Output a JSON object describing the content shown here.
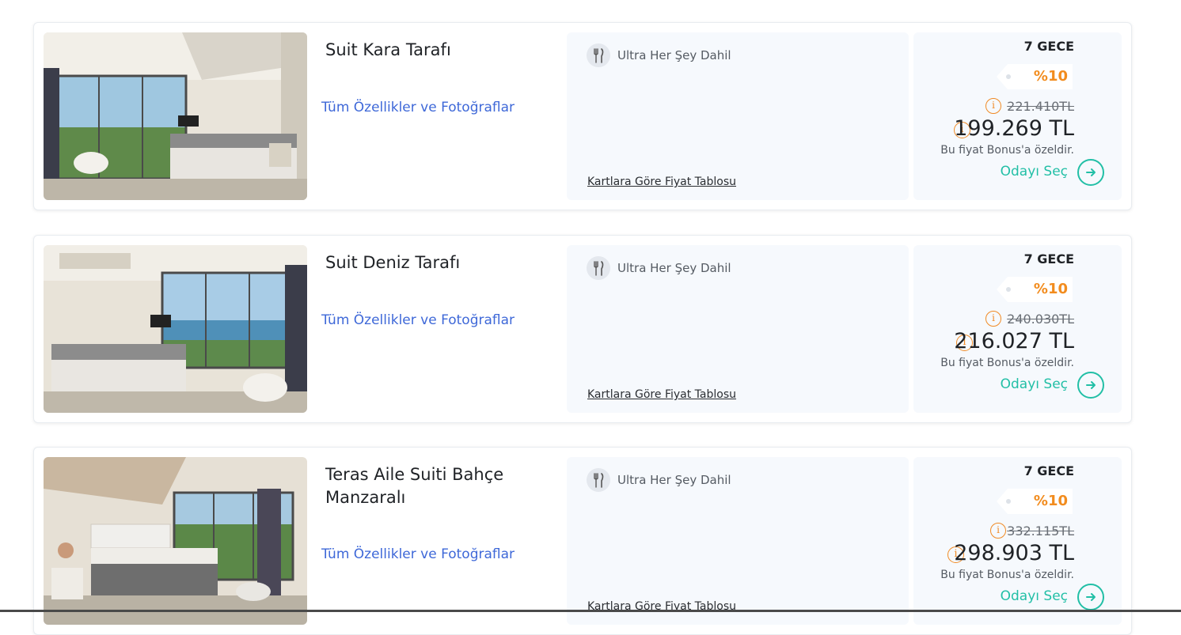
{
  "rooms": [
    {
      "name": "Suit Kara Tarafı",
      "features_link": "Tüm Özellikler ve Fotoğraflar",
      "board_type": "Ultra Her Şey Dahil",
      "board_icon": "fork-knife-icon",
      "price_table_link": "Kartlara Göre Fiyat Tablosu",
      "nights": "7 GECE",
      "discount": "%10",
      "old_price": "221.410TL",
      "price": "199.269 TL",
      "bonus_note": "Bu fiyat Bonus'a özeldir.",
      "select_label": "Odayı Seç"
    },
    {
      "name": "Suit Deniz Tarafı",
      "features_link": "Tüm Özellikler ve Fotoğraflar",
      "board_type": "Ultra Her Şey Dahil",
      "board_icon": "fork-knife-icon",
      "price_table_link": "Kartlara Göre Fiyat Tablosu",
      "nights": "7 GECE",
      "discount": "%10",
      "old_price": "240.030TL",
      "price": "216.027 TL",
      "bonus_note": "Bu fiyat Bonus'a özeldir.",
      "select_label": "Odayı Seç"
    },
    {
      "name": "Teras Aile Suiti Bahçe Manzaralı",
      "features_link": "Tüm Özellikler ve Fotoğraflar",
      "board_type": "Ultra Her Şey Dahil",
      "board_icon": "fork-knife-icon",
      "price_table_link": "Kartlara Göre Fiyat Tablosu",
      "nights": "7 GECE",
      "discount": "%10",
      "old_price": "332.115TL",
      "price": "298.903 TL",
      "bonus_note": "Bu fiyat Bonus'a özeldir.",
      "select_label": "Odayı Seç"
    }
  ],
  "colors": {
    "link_blue": "#3e68d8",
    "accent_teal": "#22bfa6",
    "discount_orange": "#f28c1e",
    "panel_bg": "#f6f9fd"
  }
}
